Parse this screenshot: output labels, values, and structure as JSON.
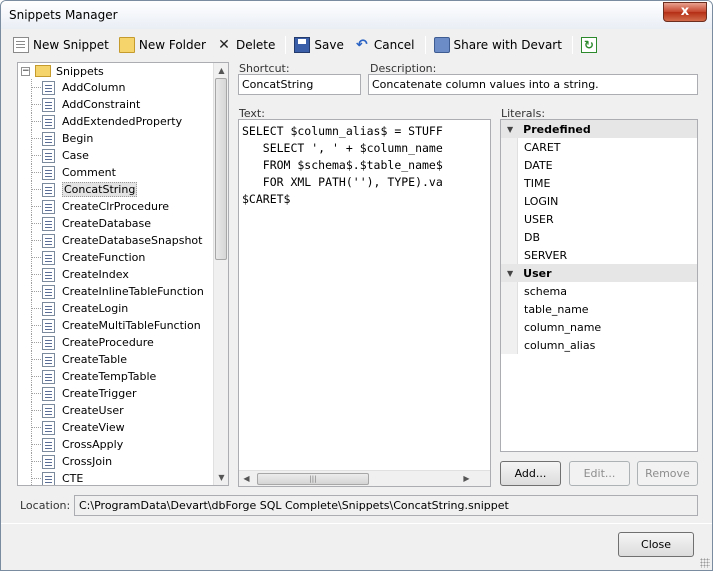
{
  "window": {
    "title": "Snippets Manager",
    "close_glyph": "x"
  },
  "toolbar": {
    "new_snippet": "New Snippet",
    "new_folder": "New Folder",
    "delete": "Delete",
    "save": "Save",
    "cancel": "Cancel",
    "share": "Share with Devart"
  },
  "tree": {
    "root_label": "Snippets",
    "items": [
      "AddColumn",
      "AddConstraint",
      "AddExtendedProperty",
      "Begin",
      "Case",
      "Comment",
      "ConcatString",
      "CreateClrProcedure",
      "CreateDatabase",
      "CreateDatabaseSnapshot",
      "CreateFunction",
      "CreateIndex",
      "CreateInlineTableFunction",
      "CreateLogin",
      "CreateMultiTableFunction",
      "CreateProcedure",
      "CreateTable",
      "CreateTempTable",
      "CreateTrigger",
      "CreateUser",
      "CreateView",
      "CrossApply",
      "CrossJoin",
      "CTE"
    ],
    "selected": "ConcatString"
  },
  "shortcut": {
    "label": "Shortcut:",
    "value": "ConcatString"
  },
  "description": {
    "label": "Description:",
    "value": "Concatenate column values into a string."
  },
  "text": {
    "label": "Text:",
    "code": "SELECT $column_alias$ = STUFF\n   SELECT ', ' + $column_name\n   FROM $schema$.$table_name$\n   FOR XML PATH(''), TYPE).va\n$CARET$"
  },
  "literals": {
    "label": "Literals:",
    "groups": [
      {
        "name": "Predefined",
        "items": [
          "CARET",
          "DATE",
          "TIME",
          "LOGIN",
          "USER",
          "DB",
          "SERVER"
        ]
      },
      {
        "name": "User",
        "items": [
          "schema",
          "table_name",
          "column_name",
          "column_alias"
        ]
      }
    ]
  },
  "buttons": {
    "add": "Add...",
    "edit": "Edit...",
    "remove": "Remove",
    "close": "Close"
  },
  "location": {
    "label": "Location:",
    "value": "C:\\ProgramData\\Devart\\dbForge SQL Complete\\Snippets\\ConcatString.snippet"
  }
}
